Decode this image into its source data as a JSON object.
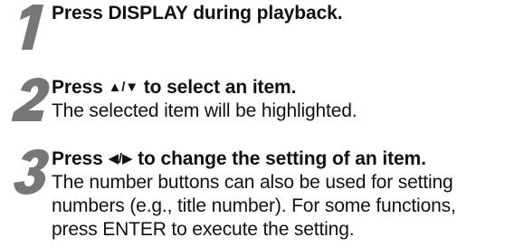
{
  "steps": [
    {
      "number": "1",
      "title": "Press DISPLAY during playback.",
      "description": []
    },
    {
      "number": "2",
      "title_prefix": "Press ",
      "title_glyph": "▲/▼",
      "title_suffix": " to select an item.",
      "description": [
        "The selected item will be highlighted."
      ]
    },
    {
      "number": "3",
      "title_prefix": "Press ",
      "title_glyph": "◀/▶",
      "title_suffix": " to change the setting of an item.",
      "description": [
        "The number buttons can also be used for setting",
        "numbers (e.g., title number). For some functions,",
        "press ENTER to execute the setting."
      ]
    }
  ]
}
